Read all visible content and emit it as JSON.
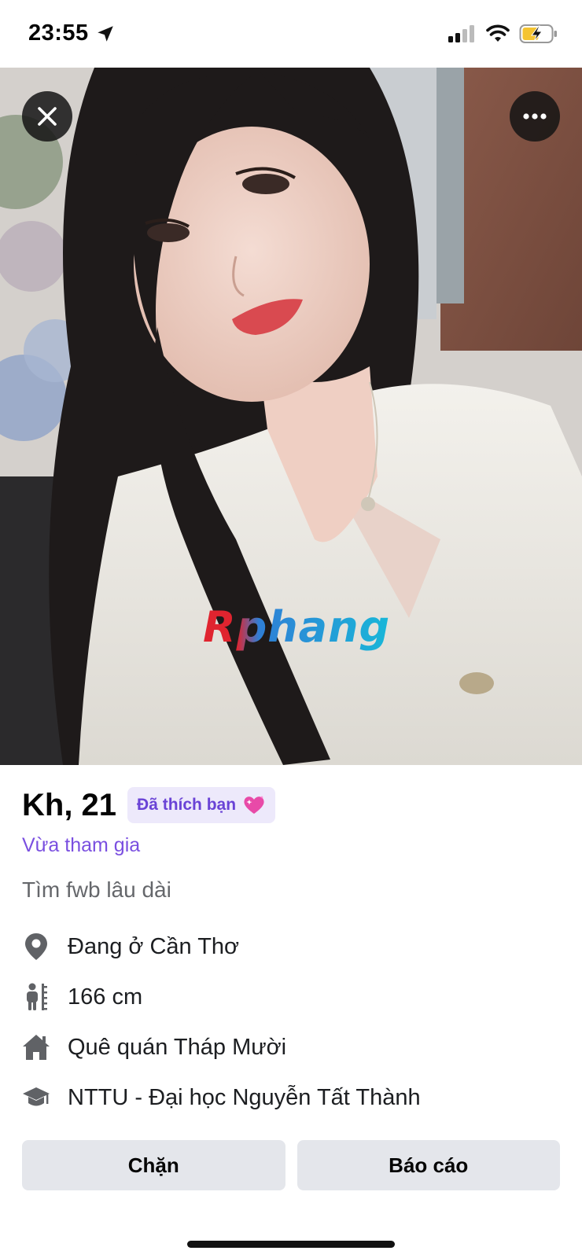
{
  "status_bar": {
    "time": "23:55"
  },
  "profile": {
    "name_age": "Kh, 21",
    "liked_badge": "Đã thích bạn",
    "joined": "Vừa tham gia",
    "looking_for": "Tìm fwb lâu dài",
    "details": [
      {
        "icon": "location-pin-icon",
        "text": "Đang ở Cần Thơ"
      },
      {
        "icon": "height-icon",
        "text": "166 cm"
      },
      {
        "icon": "home-icon",
        "text": "Quê quán Tháp Mười"
      },
      {
        "icon": "graduation-cap-icon",
        "text": "NTTU - Đại học Nguyễn Tất Thành"
      }
    ]
  },
  "photo": {
    "watermark": "Rphang"
  },
  "actions": {
    "block_label": "Chặn",
    "report_label": "Báo cáo"
  },
  "colors": {
    "accent_purple": "#7a4fe0",
    "badge_bg": "#ede9fb",
    "button_bg": "#e4e6eb"
  }
}
